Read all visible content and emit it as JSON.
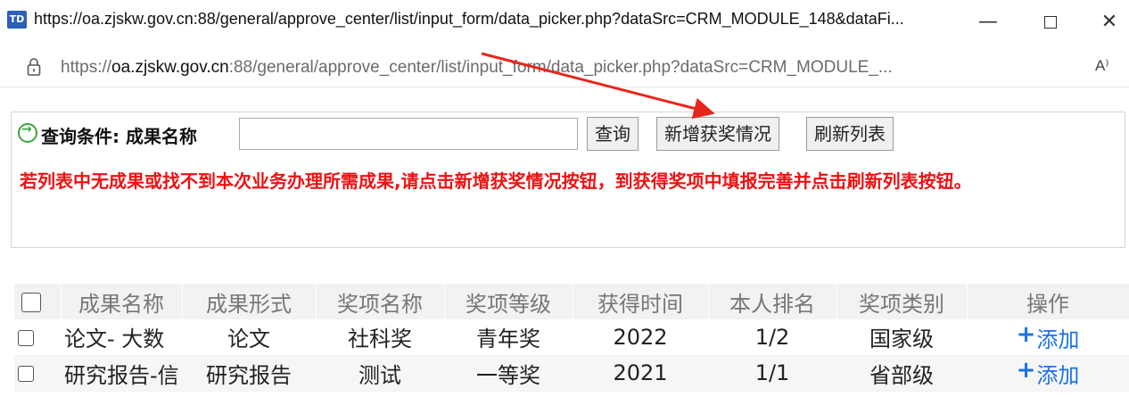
{
  "window": {
    "title": "https://oa.zjskw.gov.cn:88/general/approve_center/list/input_form/data_picker.php?dataSrc=CRM_MODULE_148&dataFi...",
    "app_icon_text": "TD",
    "minimize_glyph": "—",
    "close_glyph": "✕"
  },
  "address": {
    "url_prefix": "https://",
    "url_domain": "oa.zjskw.gov.cn",
    "url_rest": ":88/general/approve_center/list/input_form/data_picker.php?dataSrc=CRM_MODULE_...",
    "read_aloud_label": "A⁾"
  },
  "query": {
    "label": "查询条件: 成果名称",
    "input_value": "",
    "search_button": "查询",
    "add_button": "新增获奖情况",
    "refresh_button": "刷新列表"
  },
  "notice": "若列表中无成果或找不到本次业务办理所需成果,请点击新增获奖情况按钮，到获得奖项中填报完善并点击刷新列表按钮。",
  "table": {
    "headers": [
      "成果名称",
      "成果形式",
      "奖项名称",
      "奖项等级",
      "获得时间",
      "本人排名",
      "奖项类别",
      "操作"
    ],
    "rows": [
      [
        "论文- 大数",
        "论文",
        "社科奖",
        "青年奖",
        "2022",
        "1/2",
        "国家级",
        "添加"
      ],
      [
        "研究报告-信",
        "研究报告",
        "测试",
        "一等奖",
        "2021",
        "1/1",
        "省部级",
        "添加"
      ]
    ],
    "add_plus": "+"
  },
  "colors": {
    "notice": "#ee1111",
    "link": "#1a73e8",
    "arrow": "#e8251c",
    "go_icon": "#3aa53a"
  }
}
